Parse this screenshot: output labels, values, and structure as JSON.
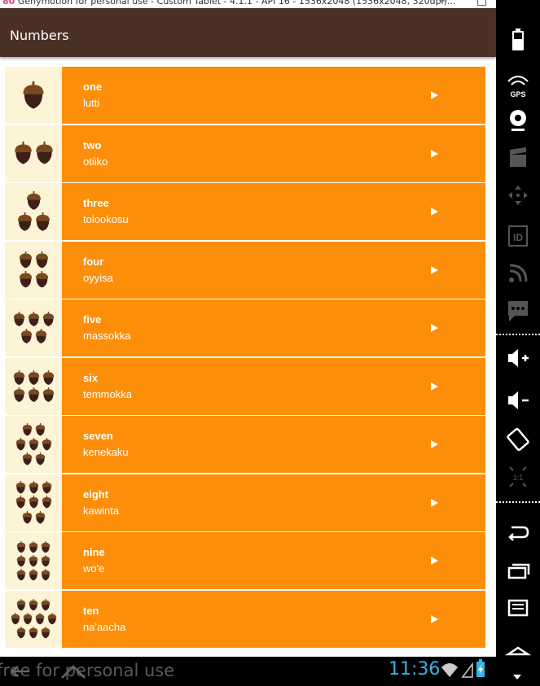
{
  "window": {
    "title": "Genymotion for personal use - Custom Tablet - 4.1.1 - API 16 - 1536x2048 (1536x2048, 320dpi)..."
  },
  "app": {
    "title": "Numbers"
  },
  "words": [
    {
      "english": "one",
      "miwok": "lutti",
      "count": 1
    },
    {
      "english": "two",
      "miwok": "otiiko",
      "count": 2
    },
    {
      "english": "three",
      "miwok": "tolookosu",
      "count": 3
    },
    {
      "english": "four",
      "miwok": "oyyisa",
      "count": 4
    },
    {
      "english": "five",
      "miwok": "massokka",
      "count": 5
    },
    {
      "english": "six",
      "miwok": "temmokka",
      "count": 6
    },
    {
      "english": "seven",
      "miwok": "kenekaku",
      "count": 7
    },
    {
      "english": "eight",
      "miwok": "kawinta",
      "count": 8
    },
    {
      "english": "nine",
      "miwok": "wo'e",
      "count": 9
    },
    {
      "english": "ten",
      "miwok": "na'aacha",
      "count": 10
    }
  ],
  "status": {
    "time": "11:36",
    "watermark": "free for personal use"
  },
  "side_toolbar": [
    "battery-icon",
    "gps-icon",
    "webcam-icon",
    "capture-icon",
    "dpad-icon",
    "device-id-icon",
    "network-icon",
    "sms-icon",
    "volume-up-icon",
    "volume-down-icon",
    "rotate-icon",
    "pixel-perfect-icon",
    "back-icon",
    "recent-apps-icon",
    "menu-icon",
    "home-icon"
  ],
  "side_labels": {
    "gps": "GPS",
    "id": "ID",
    "pixel": "1:1"
  },
  "colors": {
    "action_bar": "#4b3028",
    "row_body": "#fd8e09",
    "thumb_bg": "#fdf4d8",
    "acorn_cap": "#7a4a1e",
    "acorn_nut": "#3e2019",
    "clock": "#33b5e5"
  }
}
